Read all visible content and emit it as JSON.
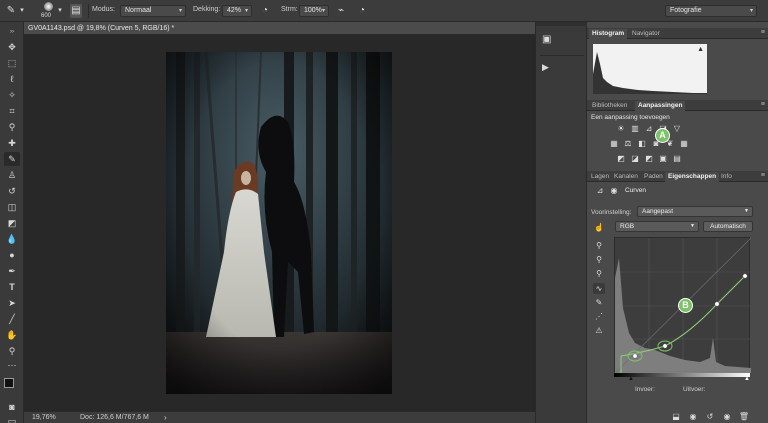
{
  "optionsbar": {
    "brush_size": "600",
    "mode_label": "Modus:",
    "mode_value": "Normaal",
    "opacity_label": "Dekking:",
    "opacity_value": "42%",
    "flow_label": "Strm:",
    "flow_value": "100%",
    "workspace": "Fotografie"
  },
  "document": {
    "tab_title": "GV0A1143.psd @ 19,8% (Curven 5, RGB/16) *",
    "zoom": "19,76%",
    "doc_size": "Doc: 126,6 M/767,6 M"
  },
  "dock": {
    "items": [
      "",
      ""
    ]
  },
  "panels": {
    "histogram_tabs": [
      "Histogram",
      "Navigator"
    ],
    "adjust_tabs": [
      "Bibliotheken",
      "Aanpassingen"
    ],
    "adjust_heading": "Een aanpassing toevoegen",
    "prop_tabs": [
      "Lagen",
      "Kanalen",
      "Paden",
      "Eigenschappen",
      "Info"
    ],
    "curves_title": "Curven",
    "preset_label": "Voorinstelling:",
    "preset_value": "Aangepast",
    "channel_value": "RGB",
    "auto_button": "Automatisch",
    "input_label": "Invoer:",
    "output_label": "Uitvoer:",
    "badge_a": "A",
    "badge_b": "B"
  },
  "colors": {
    "curve": "#8fd07a",
    "badge": "#7dc26a",
    "ui_dark": "#3c3c3c"
  }
}
